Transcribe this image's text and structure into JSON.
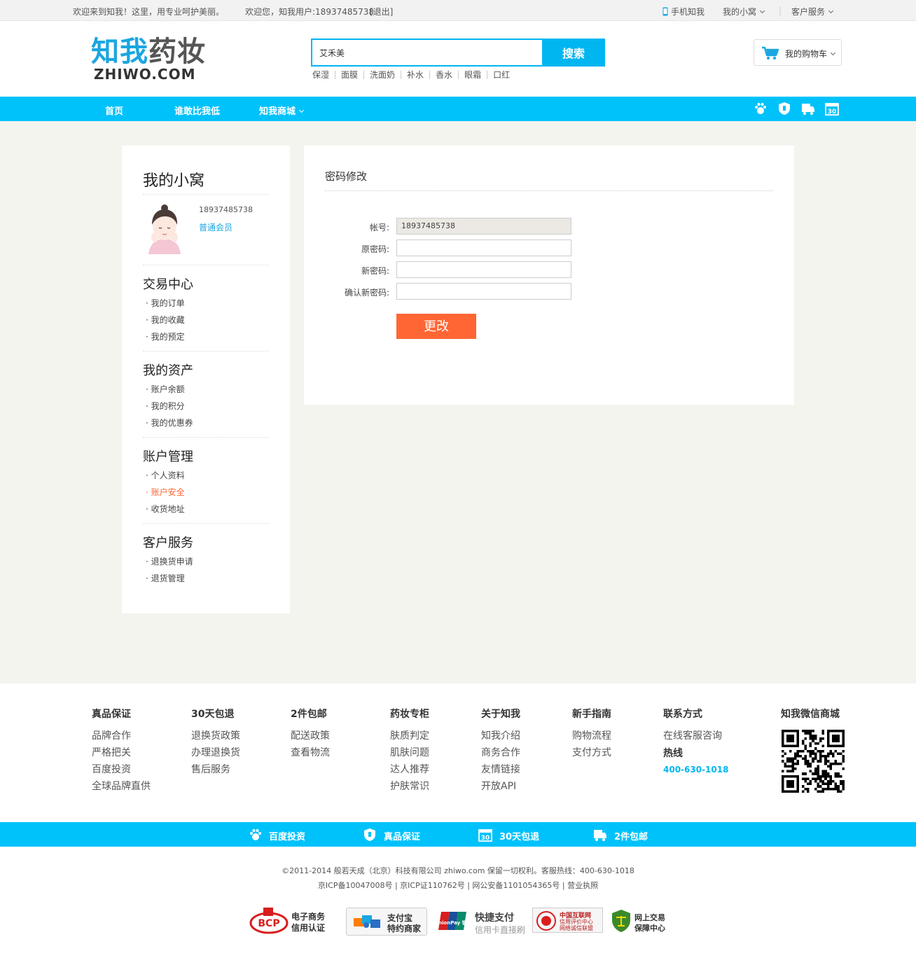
{
  "topbar": {
    "welcome": "欢迎来到知我！这里，用专业呵护美丽。",
    "greeting": "欢迎您，知我用户:18937485738",
    "logout": "[退出]",
    "mobile": "手机知我",
    "my_nest": "我的小窝",
    "service": "客户服务"
  },
  "logo": {
    "cn_a": "知我",
    "cn_b": "药妆",
    "en": "ZHIWO.COM"
  },
  "search": {
    "value": "艾禾美",
    "button": "搜索",
    "hot": [
      "保湿",
      "面膜",
      "洗面奶",
      "补水",
      "香水",
      "眼霜",
      "口红"
    ]
  },
  "cart": {
    "label": "我的购物车"
  },
  "nav": {
    "home": "首页",
    "lowest": "谁敢比我低",
    "mall": "知我商城"
  },
  "nav_icons": [
    "baidu-icon",
    "shield-icon",
    "free-shipping-icon",
    "thirty-day-icon"
  ],
  "sidebar": {
    "title": "我的小窝",
    "username": "18937485738",
    "member": "普通会员",
    "sections": [
      {
        "title": "交易中心",
        "items": [
          "· 我的订单",
          "· 我的收藏",
          "· 我的预定"
        ]
      },
      {
        "title": "我的资产",
        "items": [
          "· 账户余额",
          "· 我的积分",
          "· 我的优惠券"
        ]
      },
      {
        "title": "账户管理",
        "items": [
          "· 个人资料",
          "· 账户安全",
          "· 收货地址"
        ]
      },
      {
        "title": "客户服务",
        "items": [
          "· 退换货申请",
          "· 退货管理"
        ]
      }
    ]
  },
  "form": {
    "title": "密码修改",
    "account_label": "帐号:",
    "account_value": "18937485738",
    "old_label": "原密码:",
    "new_label": "新密码:",
    "confirm_label": "确认新密码:",
    "submit": "更改"
  },
  "footer": {
    "cols": [
      {
        "title": "真品保证",
        "items": [
          "品牌合作",
          "严格把关",
          "百度投资",
          "全球品牌直供"
        ]
      },
      {
        "title": "30天包退",
        "items": [
          "退换货政策",
          "办理退换货",
          "售后服务"
        ]
      },
      {
        "title": "2件包邮",
        "items": [
          "配送政策",
          "查看物流"
        ]
      },
      {
        "title": "药妆专柜",
        "items": [
          "肤质判定",
          "肌肤问题",
          "达人推荐",
          "护肤常识"
        ]
      },
      {
        "title": "关于知我",
        "items": [
          "知我介绍",
          "商务合作",
          "友情链接",
          "开放API"
        ]
      },
      {
        "title": "新手指南",
        "items": [
          "购物流程",
          "支付方式"
        ]
      },
      {
        "title": "联系方式",
        "items": [
          "在线客服咨询"
        ]
      }
    ],
    "hotline_label": "热线",
    "hotline": "400-630-1018",
    "wechat_title": "知我微信商城",
    "bar": [
      "百度投资",
      "真品保证",
      "30天包退",
      "2件包邮"
    ],
    "copyright": "©2011-2014 般若天成（北京）科技有限公司 zhiwo.com 保留一切权利。客服热线：400-630-1018",
    "icp": "京ICP备10047008号 | 京ICP证110762号 | 网公安备1101054365号 | 营业执照",
    "badges": [
      {
        "a": "电子商务",
        "b": "信用认证",
        "logo": "BCP"
      },
      {
        "a": "支付宝",
        "b": "特约商家"
      },
      {
        "a": "快捷支付",
        "b": "信用卡直接刷",
        "logo": "UnionPay 银联"
      },
      {
        "a": "中国互联网",
        "b": "信用评价中心",
        "c": "网络诚信联盟"
      },
      {
        "a": "网上交易",
        "b": "保障中心"
      }
    ]
  },
  "colors": {
    "brand": "#00c2fb",
    "accent": "#ff6633",
    "page_bg": "#f4f4ef"
  }
}
